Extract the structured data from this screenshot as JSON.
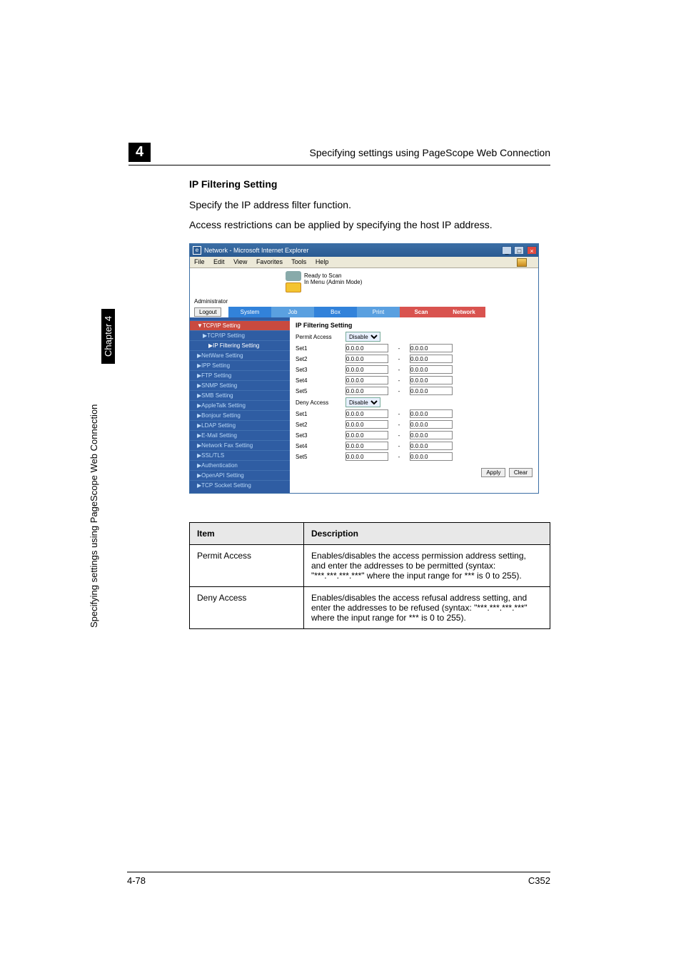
{
  "chapter_number": "4",
  "chapter_title_header": "Specifying settings using PageScope Web Connection",
  "section_title": "IP Filtering Setting",
  "intro1": "Specify the IP address filter function.",
  "intro2": "Access restrictions can be applied by specifying the host IP address.",
  "side_chapter_tag": "Chapter 4",
  "side_text": "Specifying settings using PageScope Web Connection",
  "footer_left": "4-78",
  "footer_right": "C352",
  "browser": {
    "title": "Network - Microsoft Internet Explorer",
    "menu": {
      "file": "File",
      "edit": "Edit",
      "view": "View",
      "favorites": "Favorites",
      "tools": "Tools",
      "help": "Help"
    },
    "status1": "Ready to Scan",
    "status2": "In Menu (Admin Mode)",
    "admin": "Administrator",
    "logout": "Logout",
    "tabs": {
      "system": "System",
      "job": "Job",
      "box": "Box",
      "print": "Print",
      "scan": "Scan",
      "network": "Network"
    },
    "sidebar": [
      "▼TCP/IP Setting",
      "▶TCP/IP Setting",
      "▶IP Filtering Setting",
      "▶NetWare Setting",
      "▶IPP Setting",
      "▶FTP Setting",
      "▶SNMP Setting",
      "▶SMB Setting",
      "▶AppleTalk Setting",
      "▶Bonjour Setting",
      "▶LDAP Setting",
      "▶E-Mail Setting",
      "▶Network Fax Setting",
      "▶SSL/TLS",
      "▶Authentication",
      "▶OpenAPI Setting",
      "▶TCP Socket Setting"
    ],
    "form_title": "IP Filtering Setting",
    "permit_label": "Permit Access",
    "deny_label": "Deny Access",
    "disable_opt": "Disable",
    "sets": [
      "Set1",
      "Set2",
      "Set3",
      "Set4",
      "Set5"
    ],
    "ip_default": "0.0.0.0",
    "apply": "Apply",
    "clear": "Clear"
  },
  "table": {
    "h1": "Item",
    "h2": "Description",
    "r1c1": "Permit Access",
    "r1c2": "Enables/disables the access permission address setting, and enter the addresses to be permitted (syntax: \"***.***.***.***\" where the input range for *** is 0 to 255).",
    "r2c1": "Deny Access",
    "r2c2": "Enables/disables the access refusal address setting, and enter the addresses to be refused (syntax: \"***.***.***.***\" where the input range for *** is 0 to 255)."
  }
}
